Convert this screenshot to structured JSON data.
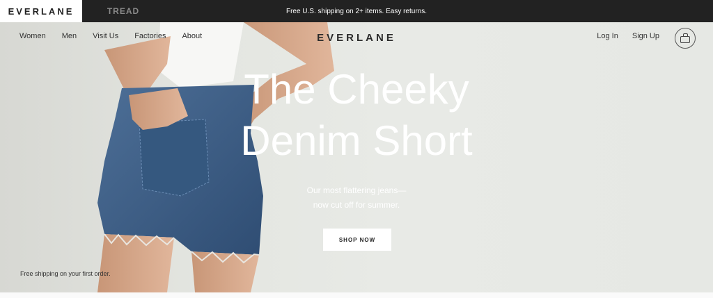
{
  "topbar": {
    "brand_everlane": "EVERLANE",
    "brand_tread": "TREAD",
    "promo_text": "Free U.S. shipping on 2+ items. Easy returns."
  },
  "nav": {
    "left_items": [
      "Women",
      "Men",
      "Visit Us",
      "Factories",
      "About"
    ],
    "logo": "EVERLANE",
    "right_items": [
      "Log In",
      "Sign Up"
    ],
    "cart_icon": "bag-icon"
  },
  "hero": {
    "headline_line1": "The Cheeky",
    "headline_line2": "Denim Short",
    "sub_line1": "Our most flattering jeans—",
    "sub_line2": "now cut off for summer.",
    "cta_label": "SHOP NOW",
    "footnote": "Free shipping on your first order."
  },
  "colors": {
    "topbar_bg": "#222222",
    "denim": "#3f6189",
    "skin": "#d9aa8c"
  }
}
